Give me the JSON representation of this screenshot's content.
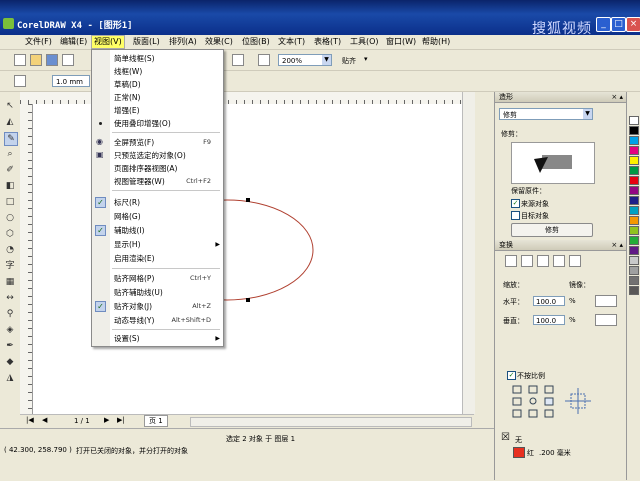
{
  "window": {
    "title": "CorelDRAW X4 - [图形1]",
    "watermark": "搜狐视频",
    "controls": [
      "_",
      "□",
      "×"
    ]
  },
  "menubar": {
    "items": [
      "文件(F)",
      "编辑(E)",
      "视图(V)",
      "版面(L)",
      "排列(A)",
      "效果(C)",
      "位图(B)",
      "文本(T)",
      "表格(T)",
      "工具(O)",
      "窗口(W)",
      "帮助(H)"
    ],
    "active_index": 2
  },
  "toolbar": {
    "zoom_value": "200%",
    "snap_label": "贴齐",
    "unit_value": "1.0 mm"
  },
  "view_menu": {
    "items": [
      {
        "label": "简单线框(S)",
        "shortcut": "",
        "state": "none",
        "submenu": false
      },
      {
        "label": "线框(W)",
        "shortcut": "",
        "state": "none",
        "submenu": false
      },
      {
        "label": "草稿(D)",
        "shortcut": "",
        "state": "none",
        "submenu": false
      },
      {
        "label": "正常(N)",
        "shortcut": "",
        "state": "none",
        "submenu": false
      },
      {
        "label": "增强(E)",
        "shortcut": "",
        "state": "none",
        "submenu": false
      },
      {
        "label": "使用叠印增强(O)",
        "shortcut": "",
        "state": "bullet",
        "submenu": false
      },
      {
        "sep": true
      },
      {
        "label": "全屏预览(F)",
        "shortcut": "F9",
        "state": "icon",
        "submenu": false
      },
      {
        "label": "只预览选定的对象(O)",
        "shortcut": "",
        "state": "icon",
        "submenu": false
      },
      {
        "label": "页面排序器视图(A)",
        "shortcut": "",
        "state": "none",
        "submenu": false
      },
      {
        "label": "视图管理器(W)",
        "shortcut": "Ctrl+F2",
        "state": "none",
        "submenu": false
      },
      {
        "sep": true
      },
      {
        "label": "标尺(R)",
        "shortcut": "",
        "state": "check",
        "submenu": false
      },
      {
        "label": "网格(G)",
        "shortcut": "",
        "state": "none",
        "submenu": false
      },
      {
        "label": "辅助线(I)",
        "shortcut": "",
        "state": "check",
        "submenu": false
      },
      {
        "label": "显示(H)",
        "shortcut": "",
        "state": "none",
        "submenu": true
      },
      {
        "label": "启用渲染(E)",
        "shortcut": "",
        "state": "none",
        "submenu": false
      },
      {
        "sep": true
      },
      {
        "label": "贴齐网格(P)",
        "shortcut": "Ctrl+Y",
        "state": "none",
        "submenu": false
      },
      {
        "label": "贴齐辅助线(U)",
        "shortcut": "",
        "state": "none",
        "submenu": false
      },
      {
        "label": "贴齐对象(J)",
        "shortcut": "Alt+Z",
        "state": "check",
        "submenu": false
      },
      {
        "label": "动态导线(Y)",
        "shortcut": "Alt+Shift+D",
        "state": "none",
        "submenu": false
      },
      {
        "sep": true
      },
      {
        "label": "设置(S)",
        "shortcut": "",
        "state": "none",
        "submenu": true
      }
    ]
  },
  "docker": {
    "shaping": {
      "title": "造形",
      "mode_value": "修剪",
      "target_label": "修剪：",
      "keep_original_label": "保留原件：",
      "source_label": "来源对象",
      "target_object_label": "目标对象",
      "source_checked": true,
      "target_checked": false,
      "apply_button": "修剪"
    },
    "transform": {
      "title": "变换",
      "scale_label": "缩放：",
      "mirror_label": "镜像：",
      "h_label": "水平：",
      "v_label": "垂直：",
      "h_value": "100.0",
      "v_value": "100.0",
      "unit": "%",
      "proportional_label": "不按比例",
      "proportional_checked": true
    },
    "fill": {
      "none_label": "无",
      "outline_label": "红",
      "outline_width": ".200 毫米",
      "outline_color": "#e83020"
    }
  },
  "page_nav": {
    "page_count": "1 / 1",
    "page_tab": "页 1"
  },
  "status": {
    "selection": "选定 2 对象 于 图层 1",
    "coords": "( 42.300, 258.790 )",
    "hint": "打开已关闭的对象，并分打开的对象"
  },
  "palette_colors": [
    "#ffffff",
    "#000000",
    "#00a0e8",
    "#e4007f",
    "#fff100",
    "#009944",
    "#e60012",
    "#920783",
    "#1d2088",
    "#00a0c0",
    "#f39800",
    "#8fc31f",
    "#22ac38",
    "#601986",
    "#c9caca",
    "#9fa0a0",
    "#727171",
    "#595757"
  ]
}
